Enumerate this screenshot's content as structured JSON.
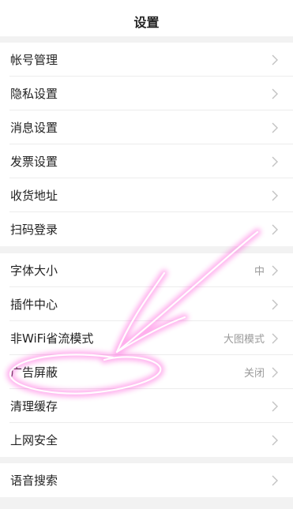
{
  "header": {
    "title": "设置"
  },
  "groups": [
    {
      "items": [
        {
          "label": "帐号管理",
          "value": ""
        },
        {
          "label": "隐私设置",
          "value": ""
        },
        {
          "label": "消息设置",
          "value": ""
        },
        {
          "label": "发票设置",
          "value": ""
        },
        {
          "label": "收货地址",
          "value": ""
        },
        {
          "label": "扫码登录",
          "value": ""
        }
      ]
    },
    {
      "items": [
        {
          "label": "字体大小",
          "value": "中"
        },
        {
          "label": "插件中心",
          "value": ""
        },
        {
          "label": "非WiFi省流模式",
          "value": "大图模式"
        },
        {
          "label": "广告屏蔽",
          "value": "关闭"
        },
        {
          "label": "清理缓存",
          "value": ""
        },
        {
          "label": "上网安全",
          "value": ""
        }
      ]
    },
    {
      "items": [
        {
          "label": "语音搜索",
          "value": ""
        }
      ]
    }
  ],
  "annotation": {
    "icon": "hand-drawn-arrow-and-circle",
    "color": "#ff4fd8"
  }
}
